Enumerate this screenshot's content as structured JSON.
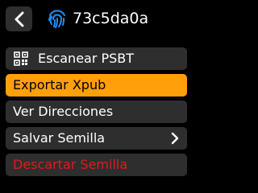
{
  "header": {
    "title": "73c5da0a",
    "back_icon": "chevron-left-icon",
    "fingerprint_icon": "fingerprint-icon",
    "accent_color": "#1e90ff"
  },
  "menu": {
    "items": [
      {
        "label": "Escanear PSBT",
        "icon": "qr-code-icon",
        "state": "normal"
      },
      {
        "label": "Exportar Xpub",
        "state": "selected"
      },
      {
        "label": "Ver Direcciones",
        "state": "normal"
      },
      {
        "label": "Salvar Semilla",
        "icon": "chevron-right-icon",
        "state": "normal"
      },
      {
        "label": "Descartar Semilla",
        "state": "destructive"
      }
    ]
  },
  "colors": {
    "background": "#000000",
    "button": "#2e2e2e",
    "selected": "#ff9f0a",
    "destructive": "#e21a1a"
  }
}
